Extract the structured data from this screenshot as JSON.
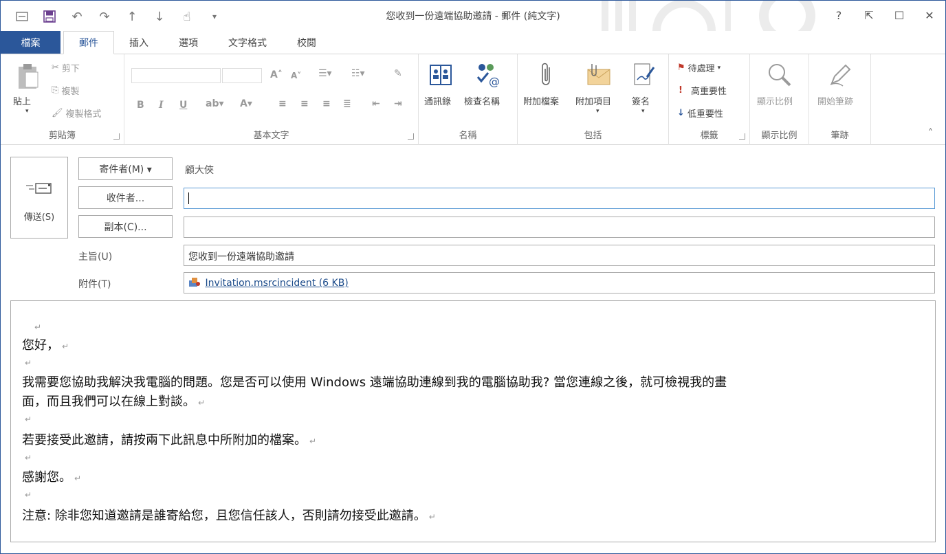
{
  "window": {
    "title": "您收到一份遠端協助邀請 - 郵件 (純文字)",
    "controls": {
      "help": "?",
      "ribbon_options": "⇱",
      "maximize": "☐",
      "close": "✕"
    }
  },
  "tabs": [
    {
      "label": "檔案"
    },
    {
      "label": "郵件"
    },
    {
      "label": "插入"
    },
    {
      "label": "選項"
    },
    {
      "label": "文字格式"
    },
    {
      "label": "校閱"
    }
  ],
  "ribbon": {
    "clipboard": {
      "group_label": "剪貼簿",
      "paste": "貼上",
      "cut": "剪下",
      "copy": "複製",
      "format_painter": "複製格式"
    },
    "basic_text": {
      "group_label": "基本文字",
      "bold": "B",
      "italic": "I",
      "underline": "U"
    },
    "names": {
      "group_label": "名稱",
      "address_book": "通訊錄",
      "check_names": "檢查名稱"
    },
    "include": {
      "group_label": "包括",
      "attach_file": "附加檔案",
      "attach_item": "附加項目",
      "signature": "簽名"
    },
    "tags": {
      "group_label": "標籤",
      "follow_up": "待處理",
      "high_importance": "高重要性",
      "low_importance": "低重要性"
    },
    "zoom": {
      "group_label": "顯示比例",
      "zoom": "顯示比例"
    },
    "ink": {
      "group_label": "筆跡",
      "start_inking": "開始筆跡"
    }
  },
  "header": {
    "send": "傳送(S)",
    "from_button": "寄件者(M) ▾",
    "from_value": "顧大俠",
    "to_button": "收件者...",
    "to_value": "",
    "cc_button": "副本(C)...",
    "cc_value": "",
    "subject_label": "主旨(U)",
    "subject_value": "您收到一份遠端協助邀請",
    "attached_label": "附件(T)",
    "attachment": "Invitation.msrcincident (6 KB)"
  },
  "body": {
    "lines": [
      "",
      "您好，",
      "",
      "我需要您協助我解決我電腦的問題。您是否可以使用  Windows  遠端協助連線到我的電腦協助我?  當您連線之後，就可檢視我的畫",
      "面，而且我們可以在線上對談。",
      "",
      "若要接受此邀請，請按兩下此訊息中所附加的檔案。",
      "",
      "感謝您。",
      "",
      "注意:  除非您知道邀請是誰寄給您，且您信任該人，否則請勿接受此邀請。"
    ],
    "paragraph_mark": "↵"
  }
}
